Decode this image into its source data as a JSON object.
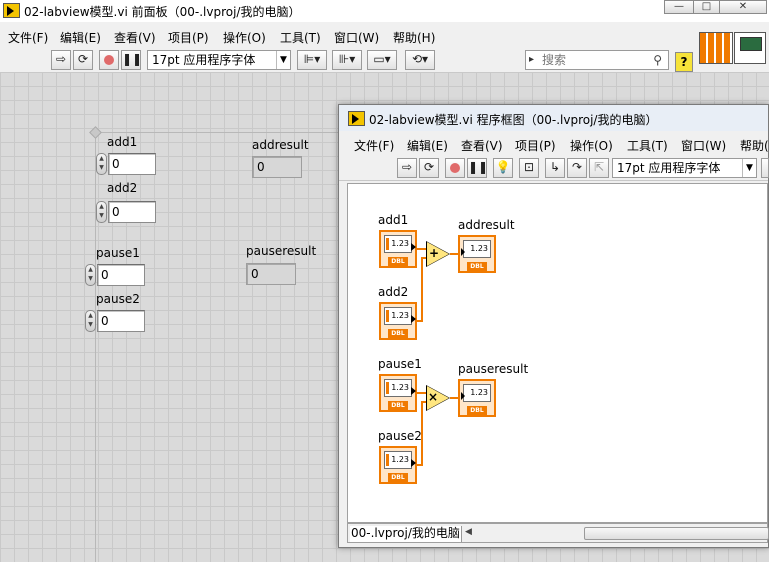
{
  "front_panel": {
    "title": "02-labview模型.vi 前面板（00-.lvproj/我的电脑）",
    "window_buttons": [
      "—",
      "□",
      "✕"
    ],
    "menu": [
      "文件(F)",
      "编辑(E)",
      "查看(V)",
      "项目(P)",
      "操作(O)",
      "工具(T)",
      "窗口(W)",
      "帮助(H)"
    ],
    "toolbar": {
      "run_icon": "run-arrow-icon",
      "run_continuous_icon": "run-continuous-icon",
      "abort_icon": "abort-icon",
      "pause_icon": "pause-icon",
      "font": "17pt 应用程序字体",
      "align_icon": "align-objects-icon",
      "distribute_icon": "distribute-objects-icon",
      "resize_icon": "resize-objects-icon",
      "reorder_icon": "reorder-icon",
      "search_placeholder": "搜索",
      "help_label": "?"
    },
    "controls": [
      {
        "label": "add1",
        "value": "0"
      },
      {
        "label": "add2",
        "value": "0"
      },
      {
        "label": "pause1",
        "value": "0"
      },
      {
        "label": "pause2",
        "value": "0"
      }
    ],
    "indicators": [
      {
        "label": "addresult",
        "value": "0"
      },
      {
        "label": "pauseresult",
        "value": "0"
      }
    ]
  },
  "block_diagram": {
    "title": "02-labview模型.vi 程序框图（00-.lvproj/我的电脑）",
    "menu": [
      "文件(F)",
      "编辑(E)",
      "查看(V)",
      "项目(P)",
      "操作(O)",
      "工具(T)",
      "窗口(W)",
      "帮助("
    ],
    "toolbar": {
      "font": "17pt 应用程序字体",
      "highlight_icon": "highlight-execution-icon",
      "retain_wire_icon": "retain-wire-values-icon",
      "step_into_icon": "step-into-icon",
      "step_over_icon": "step-over-icon",
      "step_out_icon": "step-out-icon"
    },
    "terminals": {
      "add1": {
        "label": "add1",
        "face": "1.23",
        "type": "DBL"
      },
      "add2": {
        "label": "add2",
        "face": "1.23",
        "type": "DBL"
      },
      "addresult": {
        "label": "addresult",
        "face": "1.23",
        "type": "DBL"
      },
      "pause1": {
        "label": "pause1",
        "face": "1.23",
        "type": "DBL"
      },
      "pause2": {
        "label": "pause2",
        "face": "1.23",
        "type": "DBL"
      },
      "pauseresult": {
        "label": "pauseresult",
        "face": "1.23",
        "type": "DBL"
      }
    },
    "functions": {
      "add": "+",
      "multiply": "×"
    },
    "status_path": "00-.lvproj/我的电脑"
  }
}
